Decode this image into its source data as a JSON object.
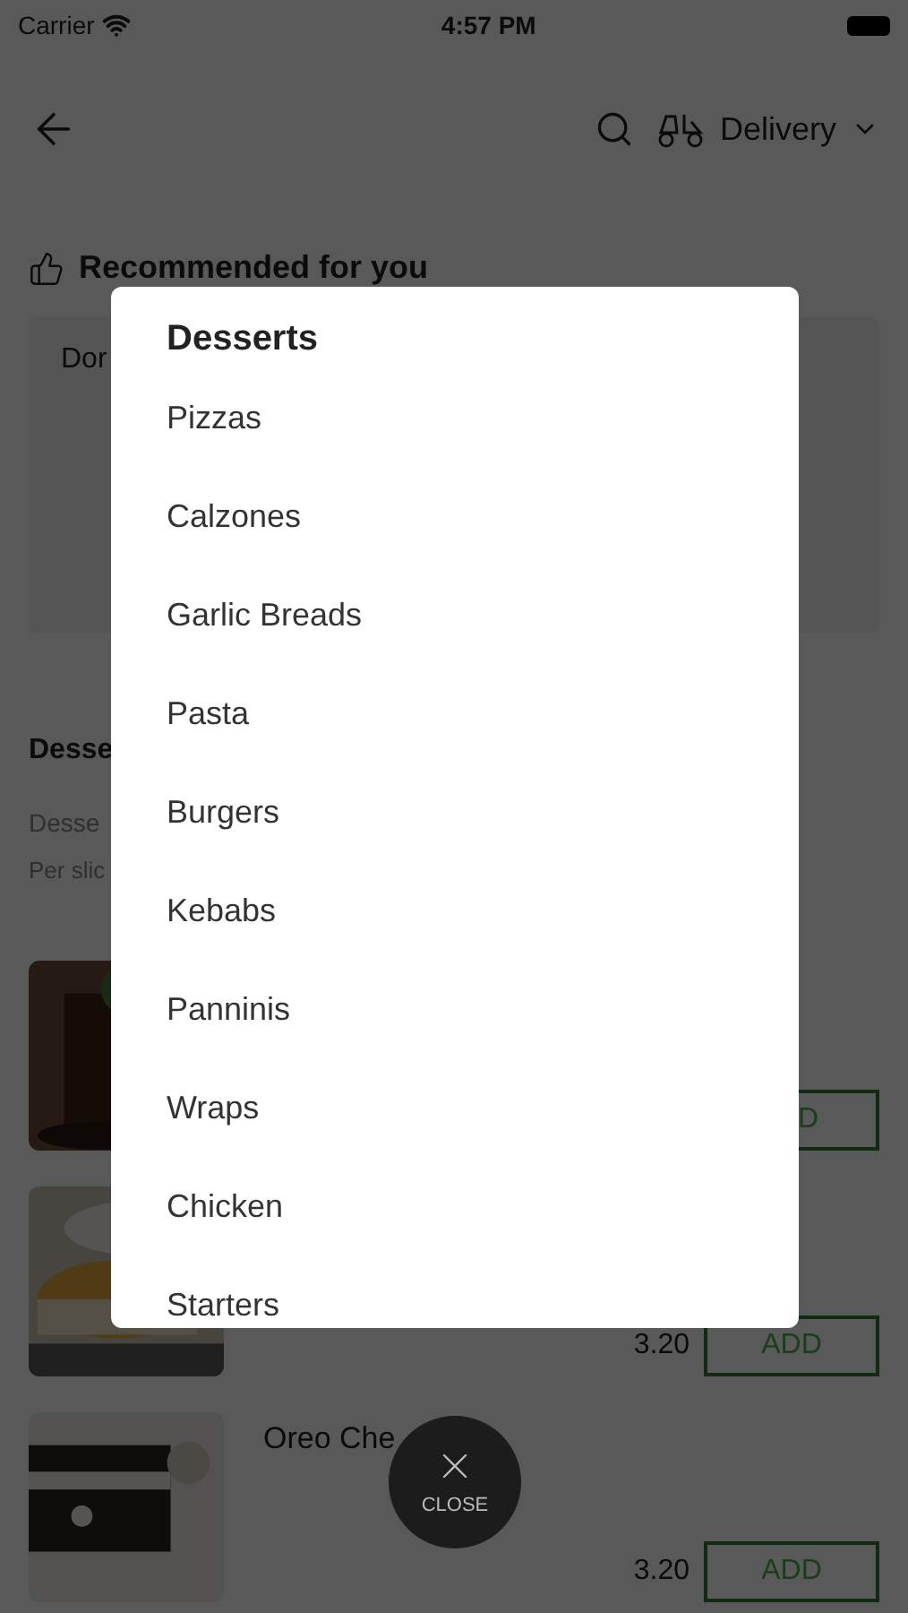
{
  "status_bar": {
    "carrier": "Carrier",
    "time": "4:57 PM"
  },
  "header": {
    "mode_label": "Delivery"
  },
  "recommended": {
    "title": "Recommended for you",
    "card_text": "Dor"
  },
  "section": {
    "title": "Desse",
    "subtitle": "Desse",
    "note": "Per slic"
  },
  "items": [
    {
      "add_label": "D"
    },
    {
      "price": "3.20",
      "add_label": "ADD"
    },
    {
      "name": "Oreo Che",
      "price": "3.20",
      "add_label": "ADD"
    }
  ],
  "menu": {
    "title": "Desserts",
    "items": [
      {
        "label": "Pizzas"
      },
      {
        "label": "Calzones"
      },
      {
        "label": "Garlic Breads"
      },
      {
        "label": "Pasta"
      },
      {
        "label": "Burgers"
      },
      {
        "label": "Kebabs"
      },
      {
        "label": "Panninis"
      },
      {
        "label": "Wraps"
      },
      {
        "label": "Chicken"
      },
      {
        "label": "Starters"
      }
    ]
  },
  "close_label": "CLOSE"
}
